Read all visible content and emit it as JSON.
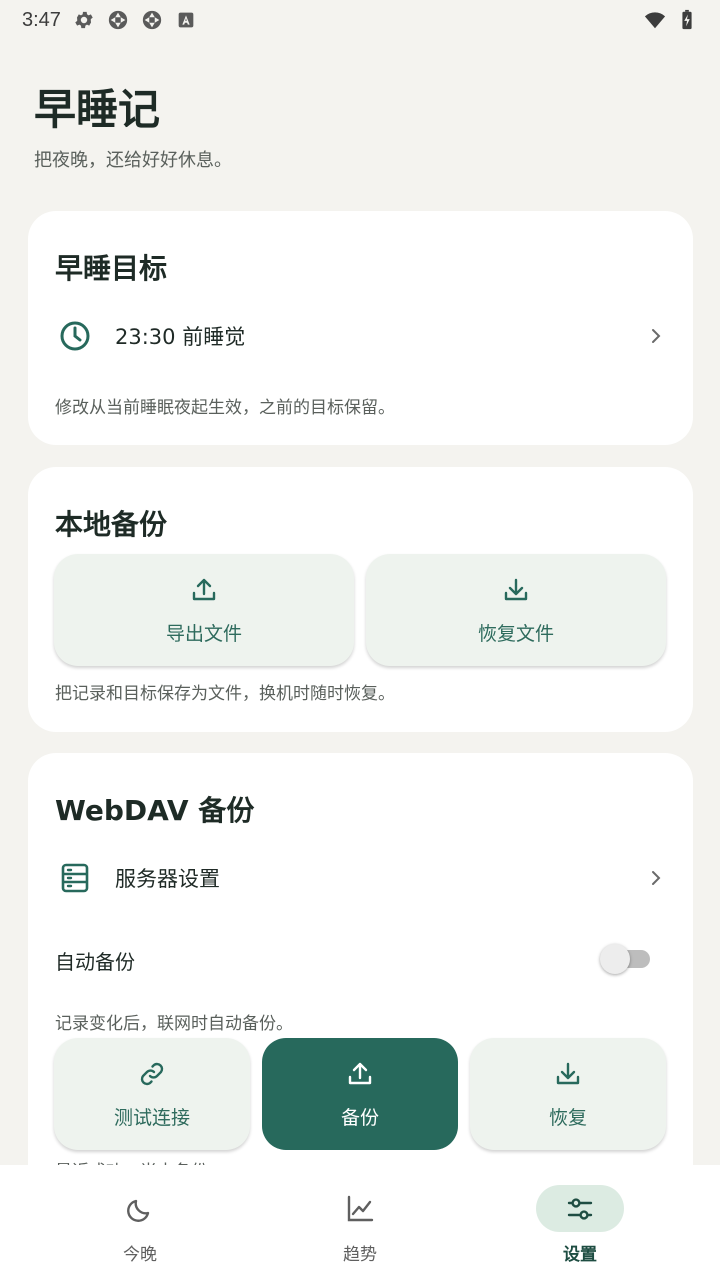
{
  "status_bar": {
    "time": "3:47",
    "left_icons": [
      "gear-icon",
      "aperture-icon",
      "aperture-icon",
      "text-a-icon"
    ],
    "right_icons": [
      "wifi-icon",
      "battery-charging-icon"
    ]
  },
  "header": {
    "title": "早睡记",
    "subtitle": "把夜晚，还给好好休息。"
  },
  "goal_card": {
    "title": "早睡目标",
    "row_label": "23:30 前睡觉",
    "row_icon": "clock-icon",
    "hint": "修改从当前睡眠夜起生效，之前的目标保留。"
  },
  "local_backup_card": {
    "title": "本地备份",
    "export_label": "导出文件",
    "restore_label": "恢复文件",
    "hint": "把记录和目标保存为文件，换机时随时恢复。"
  },
  "webdav_card": {
    "title": "WebDAV 备份",
    "server_label": "服务器设置",
    "auto_backup_label": "自动备份",
    "auto_backup_on": false,
    "auto_hint": "记录变化后，联网时自动备份。",
    "test_label": "测试连接",
    "backup_label": "备份",
    "restore_label": "恢复",
    "cut_hint": "最近成功：尚未备份"
  },
  "bottom_nav": {
    "items": [
      {
        "label": "今晚",
        "icon": "moon-icon",
        "active": false
      },
      {
        "label": "趋势",
        "icon": "trend-chart-icon",
        "active": false
      },
      {
        "label": "设置",
        "icon": "sliders-icon",
        "active": true
      }
    ]
  },
  "colors": {
    "background": "#F4F3EF",
    "accent": "#27695C",
    "button_tint": "#EEF3EE",
    "nav_active_pill": "#DCEBE2"
  }
}
